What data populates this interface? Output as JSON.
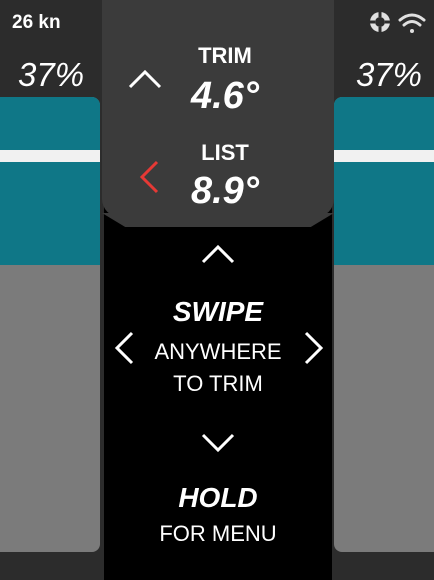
{
  "status": {
    "speed": "26 kn",
    "icons": [
      "lifebuoy-icon",
      "wifi-icon"
    ]
  },
  "tabs": {
    "left_percent": "37%",
    "right_percent": "37%"
  },
  "trim": {
    "label": "TRIM",
    "value": "4.6°"
  },
  "list": {
    "label": "LIST",
    "value": "8.9°"
  },
  "instructions": {
    "swipe_title": "SWIPE",
    "swipe_line1": "ANYWHERE",
    "swipe_line2": "TO TRIM",
    "hold_title": "HOLD",
    "hold_line": "FOR MENU"
  },
  "colors": {
    "teal": "#0f7787",
    "gray": "#7b7b7b",
    "alert": "#e53935",
    "bg": "#2c2c2c"
  }
}
